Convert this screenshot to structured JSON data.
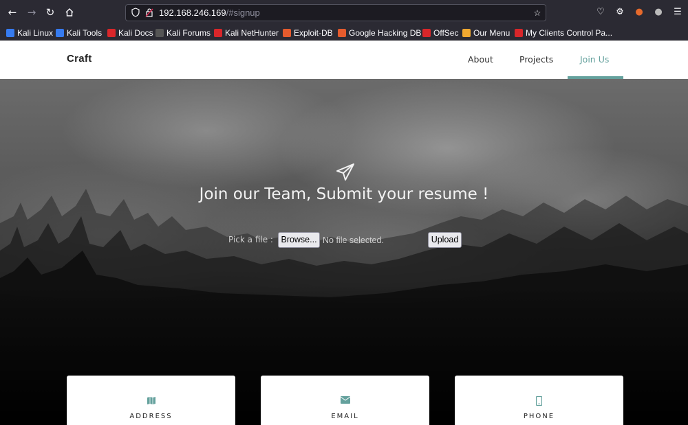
{
  "browser": {
    "url_host": "192.168.246.169",
    "url_path": "/#signup",
    "bookmarks": [
      {
        "label": "Kali Linux",
        "color": "#367bf0"
      },
      {
        "label": "Kali Tools",
        "color": "#367bf0"
      },
      {
        "label": "Kali Docs",
        "color": "#d9262a"
      },
      {
        "label": "Kali Forums",
        "color": "#1a1a1a"
      },
      {
        "label": "Kali NetHunter",
        "color": "#d9262a"
      },
      {
        "label": "Exploit-DB",
        "color": "#e55b2d"
      },
      {
        "label": "Google Hacking DB",
        "color": "#e55b2d"
      },
      {
        "label": "OffSec",
        "color": "#d9262a"
      },
      {
        "label": "Our Menu",
        "color": "#f0a830"
      },
      {
        "label": "My Clients Control Pa...",
        "color": "#d9262a"
      }
    ]
  },
  "site": {
    "brand": "Craft",
    "nav": {
      "about": "About",
      "projects": "Projects",
      "join": "Join Us"
    },
    "accent": "#64a19d",
    "hero": {
      "title": "Join our Team, Submit your resume !",
      "file_label": "Pick a file :",
      "browse_label": "Browse...",
      "file_status": "No file selected.",
      "upload_label": "Upload"
    },
    "cards": [
      {
        "icon": "map-icon",
        "label": "ADDRESS"
      },
      {
        "icon": "envelope-icon",
        "label": "EMAIL"
      },
      {
        "icon": "mobile-icon",
        "label": "PHONE"
      }
    ]
  }
}
